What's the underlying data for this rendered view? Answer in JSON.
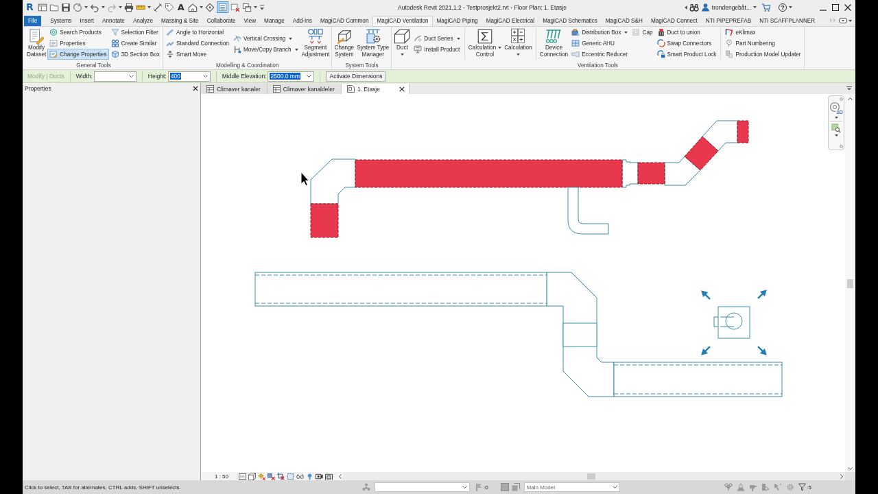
{
  "window": {
    "logo": "R",
    "title": "Autodesk Revit 2021.1.2 - Testprosjekt2.rvt - Floor Plan: 1. Etasje",
    "user": "trondengebåt...",
    "help": "?"
  },
  "quick_access": {
    "glyph": "A",
    "thin_lines": {
      "on": true
    }
  },
  "ribbon_tabs": [
    {
      "label": "File",
      "kind": "app",
      "selected": false
    },
    {
      "label": "Systems",
      "kind": "tab",
      "selected": false
    },
    {
      "label": "Insert",
      "kind": "tab",
      "selected": false
    },
    {
      "label": "Annotate",
      "kind": "tab",
      "selected": false
    },
    {
      "label": "Analyze",
      "kind": "tab",
      "selected": false
    },
    {
      "label": "Massing & Site",
      "kind": "tab",
      "selected": false
    },
    {
      "label": "Collaborate",
      "kind": "tab",
      "selected": false
    },
    {
      "label": "View",
      "kind": "tab",
      "selected": false
    },
    {
      "label": "Manage",
      "kind": "tab",
      "selected": false
    },
    {
      "label": "Add-Ins",
      "kind": "tab",
      "selected": false
    },
    {
      "label": "MagiCAD Common",
      "kind": "tab",
      "selected": false
    },
    {
      "label": "MagiCAD Ventilation",
      "kind": "tab",
      "selected": true
    },
    {
      "label": "MagiCAD Piping",
      "kind": "tab",
      "selected": false
    },
    {
      "label": "MagiCAD Electrical",
      "kind": "tab",
      "selected": false
    },
    {
      "label": "MagiCAD Schematics",
      "kind": "tab",
      "selected": false
    },
    {
      "label": "MagiCAD S&H",
      "kind": "tab",
      "selected": false
    },
    {
      "label": "MagiCAD Connect",
      "kind": "tab",
      "selected": false
    },
    {
      "label": "NTI PIPEPREFAB",
      "kind": "tab",
      "selected": false
    },
    {
      "label": "NTI SCAFFPLANNER",
      "kind": "tab",
      "selected": false
    }
  ],
  "ribbon_panels": [
    {
      "label": "General Tools",
      "groups": [
        {
          "kind": "large",
          "label": "Modify\nDataset",
          "dropdown": false
        },
        {
          "kind": "stack",
          "items": [
            {
              "label": "Search Products",
              "dropdown": false,
              "active": false
            },
            {
              "label": "Properties",
              "dropdown": false,
              "active": false
            },
            {
              "label": "Change Properties",
              "dropdown": false,
              "active": true
            }
          ]
        },
        {
          "kind": "stack",
          "items": [
            {
              "label": "Selection Filter",
              "dropdown": false,
              "active": false
            },
            {
              "label": "Create Similar",
              "dropdown": false,
              "active": false
            },
            {
              "label": "3D Section Box",
              "dropdown": false,
              "active": false
            }
          ]
        }
      ]
    },
    {
      "label": "Modelling & Coordination",
      "groups": [
        {
          "kind": "stack",
          "items": [
            {
              "label": "Angle to Horizontal",
              "dropdown": false,
              "active": false
            },
            {
              "label": "Standard Connection",
              "dropdown": false,
              "active": false
            },
            {
              "label": "Smart Move",
              "dropdown": false,
              "active": false
            }
          ]
        },
        {
          "kind": "stack",
          "items": [
            {
              "label": "Vertical Crossing",
              "dropdown": true,
              "active": false
            },
            {
              "label": "Move/Copy Branch",
              "dropdown": true,
              "active": false
            }
          ]
        },
        {
          "kind": "large",
          "label": "Segment\nAdjustment",
          "dropdown": false
        }
      ]
    },
    {
      "label": "System Tools",
      "groups": [
        {
          "kind": "large",
          "label": "Change\nSystem",
          "dropdown": false
        },
        {
          "kind": "large",
          "label": "System Type\nManager",
          "dropdown": false
        }
      ]
    },
    {
      "label": "Ventilation Tools",
      "groups": [
        {
          "kind": "large",
          "label": "Duct",
          "dropdown": true
        },
        {
          "kind": "stack",
          "items": [
            {
              "label": "Duct Series",
              "dropdown": true,
              "active": false
            },
            {
              "label": "Install Product",
              "dropdown": false,
              "active": false
            }
          ]
        },
        {
          "kind": "separator"
        },
        {
          "kind": "large",
          "label": "Calculation\nControl",
          "dropdown": true
        },
        {
          "kind": "large",
          "label": "Calculation",
          "dropdown": true
        },
        {
          "kind": "separator"
        },
        {
          "kind": "large",
          "label": "Device\nConnection",
          "dropdown": false
        },
        {
          "kind": "stack",
          "items": [
            {
              "label": "Distribution Box",
              "dropdown": true,
              "active": false
            },
            {
              "label": "Generic AHU",
              "dropdown": false,
              "active": false
            },
            {
              "label": "Eccentric Reducer",
              "dropdown": false,
              "active": false
            }
          ]
        },
        {
          "kind": "stack",
          "items": [
            {
              "label": "Cap",
              "dropdown": false,
              "active": false
            }
          ]
        },
        {
          "kind": "stack",
          "items": [
            {
              "label": "Duct to union",
              "dropdown": false,
              "active": false
            },
            {
              "label": "Swap Connectors",
              "dropdown": false,
              "active": false
            },
            {
              "label": "Smart Product Lock",
              "dropdown": false,
              "active": false
            }
          ]
        },
        {
          "kind": "separator"
        },
        {
          "kind": "stack",
          "items": [
            {
              "label": "eKlimax",
              "dropdown": false,
              "active": false
            },
            {
              "label": "Part Numbering",
              "dropdown": false,
              "active": false
            },
            {
              "label": "Production Model Updater",
              "dropdown": false,
              "active": false
            }
          ]
        }
      ]
    }
  ],
  "options_bar": {
    "context": "Modify | Ducts",
    "fields": [
      {
        "label": "Width:",
        "highlighted": false
      },
      {
        "label": "Height:",
        "value": "400",
        "highlighted": true
      },
      {
        "label": "Middle Elevation:",
        "value": "2500.0 mm",
        "highlighted": true
      }
    ],
    "button": "Activate Dimensions"
  },
  "properties": {
    "title": "Properties"
  },
  "view_tabs": [
    {
      "label": "Climaver kanaler",
      "kind": "schedule",
      "selected": false
    },
    {
      "label": "Climaver kanaldeler",
      "kind": "schedule",
      "selected": false
    },
    {
      "label": "1. Etasje",
      "kind": "plan",
      "selected": true
    }
  ],
  "view": {
    "navigation_bar": {
      "wheel_label": "2D"
    },
    "runs": [
      {
        "selected": true
      },
      {
        "selected": false
      }
    ],
    "scale": "1 : 50"
  },
  "status_bar": {
    "message": "Click to select, TAB for alternates, CTRL adds, SHIFT unselects.",
    "editable_count": ":0",
    "model": "Main Model",
    "filter_count": ":5"
  }
}
